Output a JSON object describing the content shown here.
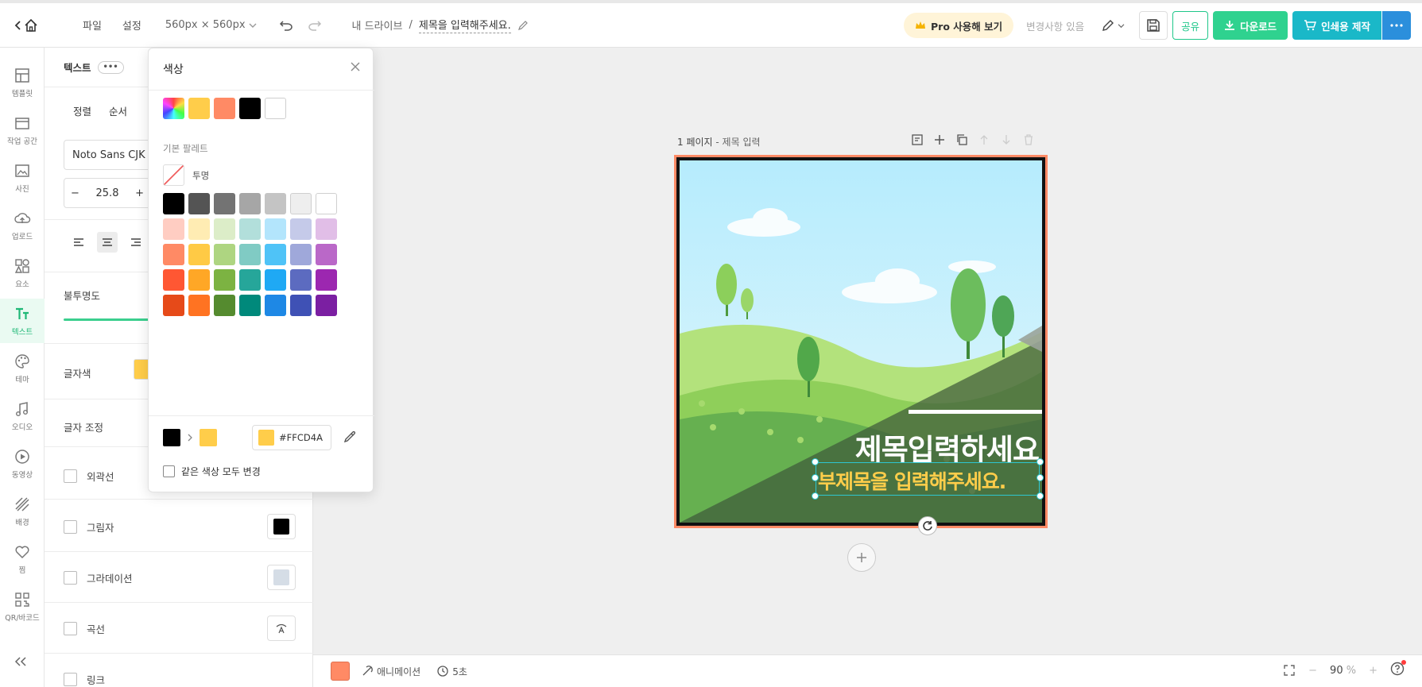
{
  "topbar": {
    "menu": [
      "파일",
      "설정"
    ],
    "size": "560px × 560px",
    "breadcrumb_root": "내 드라이브",
    "breadcrumb_sep": "/",
    "doc_title": "제목을 입력해주세요.",
    "pro_label": "Pro 사용해 보기",
    "changes_label": "변경사항 있음",
    "share_label": "공유",
    "download_label": "다운로드",
    "print_label": "인쇄용 제작"
  },
  "rail": {
    "items": [
      "템플릿",
      "작업 공간",
      "사진",
      "업로드",
      "요소",
      "텍스트",
      "테마",
      "오디오",
      "동영상",
      "배경",
      "찜",
      "QR/바코드"
    ],
    "active": "텍스트"
  },
  "panel": {
    "title": "텍스트",
    "tabs": [
      "정렬",
      "순서"
    ],
    "font": "Noto Sans CJK",
    "font_size": "25.8",
    "opacity_label": "불투명도",
    "font_color_label": "글자색",
    "spacing_label": "글자 조정",
    "options": [
      "외곽선",
      "그림자",
      "그라데이션",
      "곡선",
      "링크"
    ]
  },
  "color_popup": {
    "title": "색상",
    "recent_colors": [
      "#FFCD4A",
      "#FF8A65",
      "#000000",
      "#FFFFFF"
    ],
    "palette_label": "기본 팔레트",
    "transparent_label": "투명",
    "palette": [
      [
        "#000000",
        "#545454",
        "#737373",
        "#A6A6A6",
        "#C4C4C4",
        "#EEEEEE",
        "#FFFFFF"
      ],
      [
        "#FFCDC2",
        "#FFECB3",
        "#DCEDC8",
        "#B2DFDB",
        "#B3E5FC",
        "#C5CAE9",
        "#E1BEE7"
      ],
      [
        "#FF8A65",
        "#FFCA45",
        "#AED581",
        "#80CBC4",
        "#4FC3F7",
        "#9FA8DA",
        "#BA68C8"
      ],
      [
        "#FF5733",
        "#FFA726",
        "#7CB342",
        "#26A69A",
        "#1FA9F4",
        "#5C6BC0",
        "#9C27B0"
      ],
      [
        "#E64A19",
        "#FF7322",
        "#558B2F",
        "#00897B",
        "#1E88E5",
        "#3F51B5",
        "#7B1FA2"
      ]
    ],
    "from_color": "#000000",
    "to_color": "#FFCD4A",
    "hex_value": "#FFCD4A",
    "same_color_label": "같은 색상 모두 변경"
  },
  "canvas": {
    "page_label_num": "1 페이지",
    "page_label_title": "- 제목 입력",
    "heading": "제목입력하세요",
    "subheading": "부제목을 입력해주세요."
  },
  "bottombar": {
    "animation_label": "애니메이션",
    "time_label": "5초",
    "zoom": "90",
    "zoom_unit": "%"
  }
}
